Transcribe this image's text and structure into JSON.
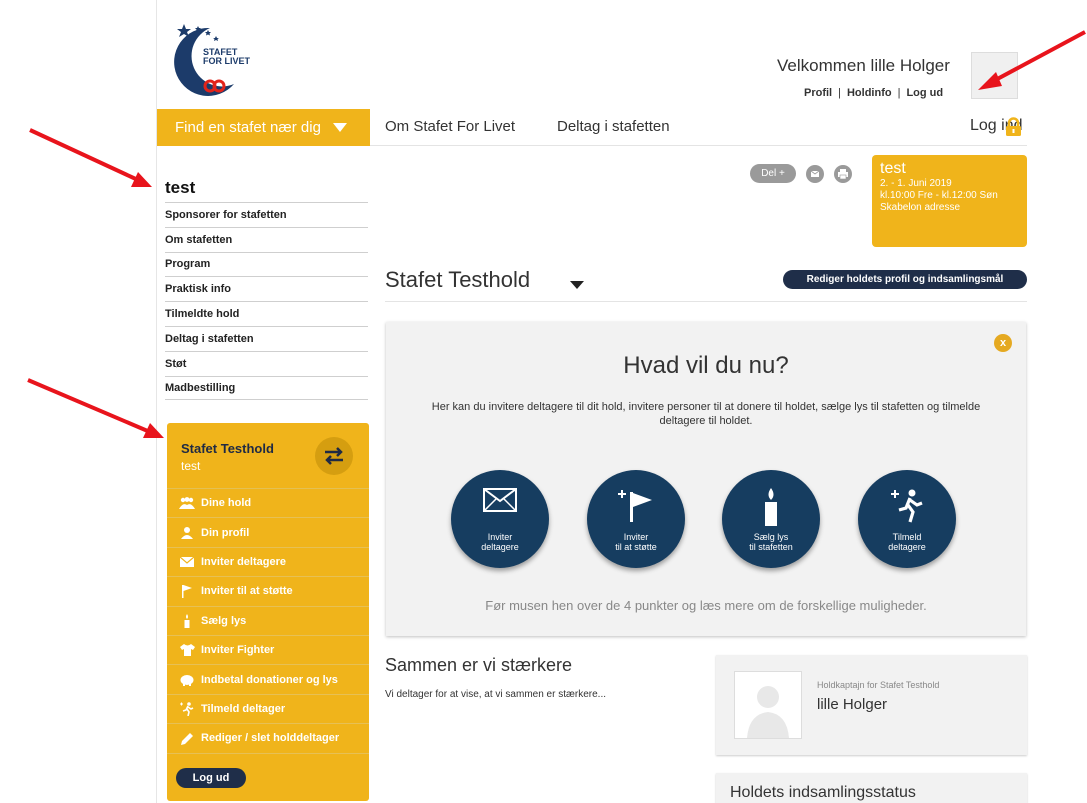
{
  "logo": {
    "line1": "STAFET",
    "line2": "FOR LIVET"
  },
  "header": {
    "welcome": "Velkommen lille Holger",
    "links": [
      "Profil",
      "Holdinfo",
      "Log ud"
    ],
    "sep": "|"
  },
  "nav": {
    "find_label": "Find en stafet nær dig",
    "items": [
      "Om Stafet For Livet",
      "Deltag i stafetten"
    ],
    "login_label": "Log ind"
  },
  "sidebar": {
    "title": "test",
    "items": [
      "Sponsorer for stafetten",
      "Om stafetten",
      "Program",
      "Praktisk info",
      "Tilmeldte hold",
      "Deltag i stafetten",
      "Støt",
      "Madbestilling"
    ]
  },
  "team_panel": {
    "team_name": "Stafet Testhold",
    "event_name": "test",
    "items": [
      {
        "label": "Dine hold",
        "icon": "group-icon"
      },
      {
        "label": "Din profil",
        "icon": "person-icon"
      },
      {
        "label": "Inviter deltagere",
        "icon": "envelope-icon"
      },
      {
        "label": "Inviter til at støtte",
        "icon": "flag-icon"
      },
      {
        "label": "Sælg lys",
        "icon": "candle-icon"
      },
      {
        "label": "Inviter Fighter",
        "icon": "tshirt-icon"
      },
      {
        "label": "Indbetal donationer og lys",
        "icon": "piggybank-icon"
      },
      {
        "label": "Tilmeld deltager",
        "icon": "runner-icon"
      },
      {
        "label": "Rediger / slet holddeltager",
        "icon": "pencil-icon"
      }
    ],
    "logout_label": "Log ud"
  },
  "share": {
    "del_label": "Del +"
  },
  "event_box": {
    "title": "test",
    "dates": "2. - 1. Juni 2019",
    "times": "kl.10:00 Fre - kl.12:00 Søn",
    "address": "Skabelon adresse"
  },
  "team_header": {
    "title": "Stafet Testhold",
    "edit_label": "Rediger holdets profil og indsamlingsmål"
  },
  "main_box": {
    "close_label": "x",
    "heading": "Hvad vil du nu?",
    "description": "Her kan du invitere deltagere til dit hold, invitere personer til at donere til holdet, sælge lys til stafetten og tilmelde deltagere til holdet.",
    "actions": [
      {
        "line1": "Inviter",
        "line2": "deltagere",
        "icon": "envelope-icon"
      },
      {
        "line1": "Inviter",
        "line2": "til at støtte",
        "icon": "flag-icon"
      },
      {
        "line1": "Sælg lys",
        "line2": "til stafetten",
        "icon": "candle-icon"
      },
      {
        "line1": "Tilmeld",
        "line2": "deltagere",
        "icon": "runner-icon"
      }
    ],
    "footer": "Før musen hen over de 4 punkter og læs mere om de forskellige muligheder."
  },
  "about": {
    "title": "Sammen er vi stærkere",
    "text": "Vi deltager for at vise, at vi sammen er stærkere..."
  },
  "captain": {
    "role": "Holdkaptajn for Stafet Testhold",
    "name": "lille Holger"
  },
  "status": {
    "title": "Holdets indsamlingsstatus"
  },
  "colors": {
    "brand_yellow": "#f0b41b",
    "navy": "#163d60",
    "arrow_red": "#e8141c"
  }
}
